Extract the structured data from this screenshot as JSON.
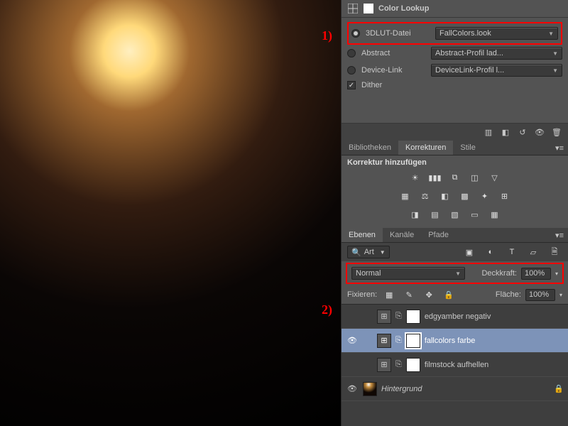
{
  "annotations": {
    "one": "1)",
    "two": "2)"
  },
  "colorLookup": {
    "title": "Color Lookup",
    "options": {
      "lut": {
        "label": "3DLUT-Datei",
        "value": "FallColors.look",
        "selected": true
      },
      "abstract": {
        "label": "Abstract",
        "value": "Abstract-Profil lad..."
      },
      "devicelink": {
        "label": "Device-Link",
        "value": "DeviceLink-Profil l..."
      },
      "dither": {
        "label": "Dither",
        "checked": true
      }
    }
  },
  "adjustmentTabs": {
    "bibliotheken": "Bibliotheken",
    "korrekturen": "Korrekturen",
    "stile": "Stile",
    "subtitle": "Korrektur hinzufügen"
  },
  "layerTabs": {
    "ebenen": "Ebenen",
    "kanaele": "Kanäle",
    "pfade": "Pfade"
  },
  "layersPanel": {
    "filterLabel": "Art",
    "blendMode": "Normal",
    "opacityLabel": "Deckkraft:",
    "opacityValue": "100%",
    "lockLabel": "Fixieren:",
    "fillLabel": "Fläche:",
    "fillValue": "100%",
    "layers": [
      {
        "name": "edgyamber negativ",
        "visible": false,
        "selected": false,
        "adjustment": true
      },
      {
        "name": "fallcolors farbe",
        "visible": true,
        "selected": true,
        "adjustment": true
      },
      {
        "name": "filmstock aufhellen",
        "visible": false,
        "selected": false,
        "adjustment": true
      },
      {
        "name": "Hintergrund",
        "visible": true,
        "selected": false,
        "adjustment": false
      }
    ]
  }
}
